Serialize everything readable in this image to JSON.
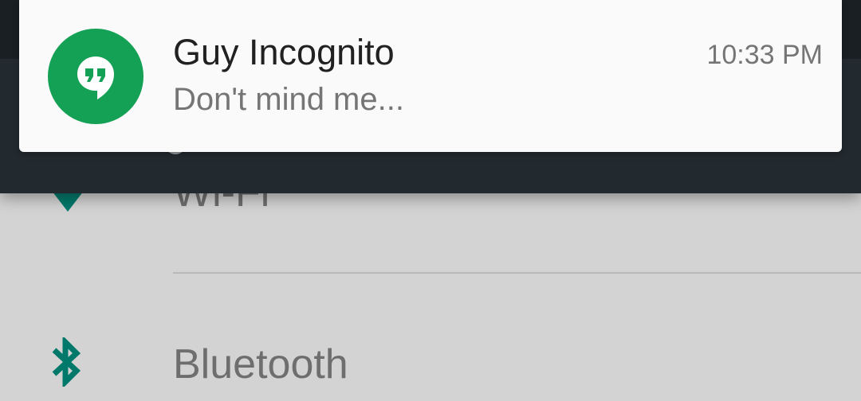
{
  "notification": {
    "app_icon": "hangouts-icon",
    "title": "Guy Incognito",
    "message": "Don't mind me...",
    "time": "10:33 PM",
    "avatar_color": "#15a155"
  },
  "settings": {
    "items": [
      {
        "label": "Wi-Fi",
        "icon": "wifi-icon"
      },
      {
        "label": "Bluetooth",
        "icon": "bluetooth-icon"
      }
    ],
    "accent_color": "#00796b"
  }
}
